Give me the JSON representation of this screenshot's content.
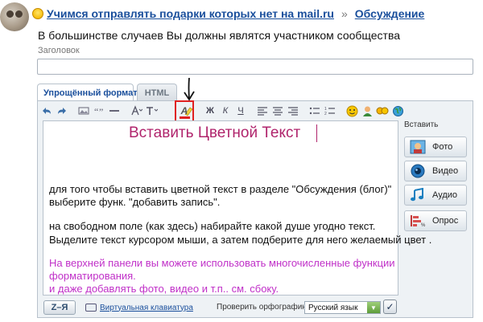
{
  "header": {
    "topic_link": "Учимся отправлять подарки которых нет на mail.ru",
    "separator": "»",
    "section_link": "Обсуждение"
  },
  "subtitle": "В большинстве случаев Вы должны являтся участником сообщества",
  "title_field": {
    "label": "Заголовок",
    "value": ""
  },
  "tabs": [
    {
      "label": "Упрощённый формат",
      "active": true
    },
    {
      "label": "HTML",
      "active": false
    }
  ],
  "toolbar": {
    "items": [
      "undo-icon",
      "redo-icon",
      "image-icon",
      "quote-icon",
      "line-icon",
      "font-icon",
      "font-size-icon",
      "text-color-icon",
      "highlight-icon",
      "bold-icon",
      "italic-icon",
      "underline-icon",
      "align-left-icon",
      "align-center-icon",
      "align-right-icon",
      "bulleted-list-icon",
      "numbered-list-icon",
      "smiley-icon",
      "person-icon",
      "group-icon",
      "globe-icon"
    ],
    "glyphs": {
      "bold": "Ж",
      "italic": "К",
      "underline": "Ч",
      "color_letter": "A"
    },
    "accent_color": "#e02020"
  },
  "editor": {
    "heading": "Вставить Цветной Текст",
    "heading_color": "#b0246c",
    "paragraph1": [
      "для того чтобы вставить цветной текст в разделе \"Обсуждения (блог)\"",
      "выберите функ. \"добавить запись\"."
    ],
    "paragraph2": [
      "на свободном поле (как здесь) набирайте какой душе угодно текст.",
      "Выделите текст курсором мыши, а затем подберите для него желаемый цвет ."
    ],
    "paragraph3": [
      "На верхней панели вы можете использовать многочисленные функции",
      "форматирования.",
      "и даже добавлять фото, видео и т.п.. см. сбоку."
    ],
    "paragraph3_color": "#c030c8"
  },
  "side_panel": {
    "label": "Вставить",
    "buttons": [
      {
        "label": "Фото",
        "icon": "photo-icon"
      },
      {
        "label": "Видео",
        "icon": "video-icon"
      },
      {
        "label": "Аудио",
        "icon": "audio-icon"
      },
      {
        "label": "Опрос",
        "icon": "poll-icon"
      }
    ]
  },
  "bottom_bar": {
    "layout_button": "Z–Я",
    "virtual_keyboard": "Виртуальная клавиатура",
    "spell_check_label": "Проверить орфографию",
    "language": "Русский язык",
    "check_glyph": "✓"
  }
}
